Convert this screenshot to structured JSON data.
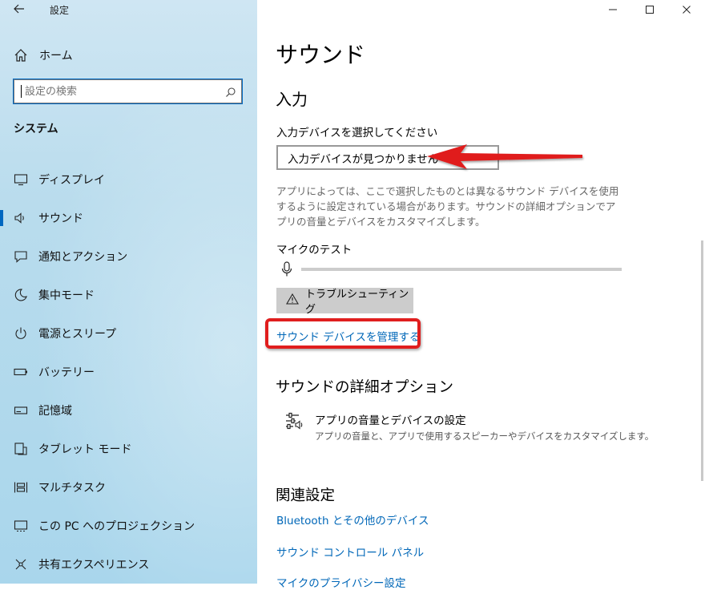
{
  "window": {
    "title": "設定",
    "back_icon": "arrow-left-icon",
    "controls": {
      "minimize": "—",
      "maximize": "☐",
      "close": "✕"
    }
  },
  "sidebar": {
    "home_label": "ホーム",
    "search_placeholder": "設定の検索",
    "section": "システム",
    "items": [
      {
        "label": "ディスプレイ",
        "icon": "display-icon"
      },
      {
        "label": "サウンド",
        "icon": "speaker-icon",
        "selected": true
      },
      {
        "label": "通知とアクション",
        "icon": "notification-icon"
      },
      {
        "label": "集中モード",
        "icon": "moon-icon"
      },
      {
        "label": "電源とスリープ",
        "icon": "power-icon"
      },
      {
        "label": "バッテリー",
        "icon": "battery-icon"
      },
      {
        "label": "記憶域",
        "icon": "storage-icon"
      },
      {
        "label": "タブレット モード",
        "icon": "tablet-icon"
      },
      {
        "label": "マルチタスク",
        "icon": "multitask-icon"
      },
      {
        "label": "この PC へのプロジェクション",
        "icon": "projection-icon"
      },
      {
        "label": "共有エクスペリエンス",
        "icon": "share-icon"
      }
    ]
  },
  "main": {
    "title": "サウンド",
    "input_heading": "入力",
    "device_label": "入力デバイスを選択してください",
    "device_value": "入力デバイスが見つかりません",
    "description": "アプリによっては、ここで選択したものとは異なるサウンド デバイスを使用するように設定されている場合があります。サウンドの詳細オプションでアプリの音量とデバイスをカスタマイズします。",
    "mic_test_label": "マイクのテスト",
    "mic_level": 0,
    "troubleshoot_label": "トラブルシューティング",
    "manage_link": "サウンド デバイスを管理する",
    "advanced_heading": "サウンドの詳細オプション",
    "advanced_item_title": "アプリの音量とデバイスの設定",
    "advanced_item_sub": "アプリの音量と、アプリで使用するスピーカーやデバイスをカスタマイズします。",
    "related_heading": "関連設定",
    "related_links": [
      "Bluetooth とその他のデバイス",
      "サウンド コントロール パネル",
      "マイクのプライバシー設定"
    ]
  },
  "colors": {
    "accent": "#0067c0",
    "link": "#0067b8",
    "annotation_red": "#e01e1e"
  }
}
